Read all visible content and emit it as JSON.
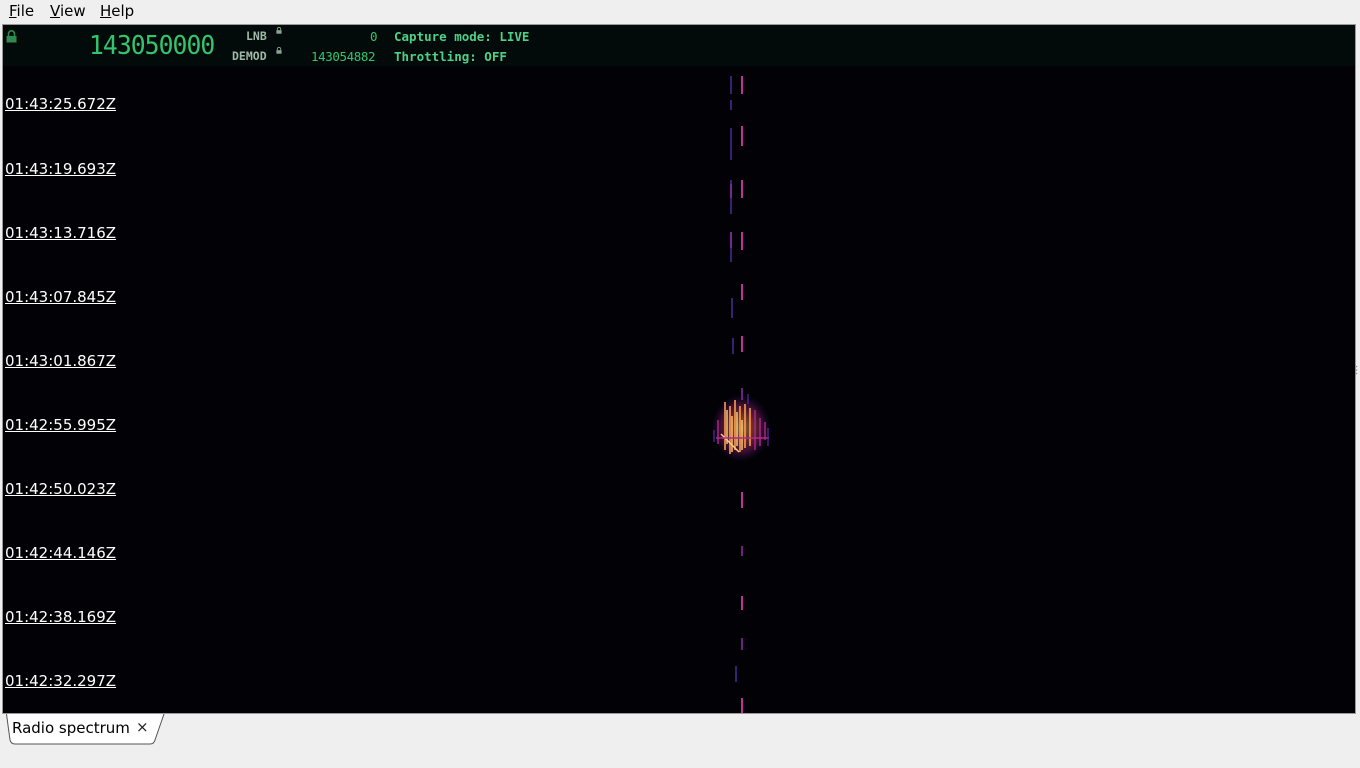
{
  "menu": {
    "file": {
      "mnemonic": "F",
      "rest": "ile"
    },
    "view": {
      "mnemonic": "V",
      "rest": "iew"
    },
    "help": {
      "mnemonic": "H",
      "rest": "elp"
    }
  },
  "status": {
    "main_frequency": "143050000",
    "lnb_label": "LNB",
    "lnb_value": "0",
    "demod_label": "DEMOD",
    "demod_value": "143054882",
    "capture_mode": "Capture mode: LIVE",
    "throttling": "Throttling: OFF"
  },
  "waterfall": {
    "timestamps": [
      "01:43:25.672Z",
      "01:43:19.693Z",
      "01:43:13.716Z",
      "01:43:07.845Z",
      "01:43:01.867Z",
      "01:42:55.995Z",
      "01:42:50.023Z",
      "01:42:44.146Z",
      "01:42:38.169Z",
      "01:42:32.297Z"
    ]
  },
  "tabs": [
    {
      "label": "Radio spectrum",
      "close_symbol": "×"
    }
  ],
  "colors": {
    "frequency_green": "#34c46e",
    "status_bg": "#020b09",
    "waterfall_bg": "#020106",
    "signal_magenta": "#c0309a",
    "signal_violet": "#5a2aa0",
    "burst_hot": "#ffc06a"
  },
  "icons": {
    "lock": "lock-icon"
  }
}
